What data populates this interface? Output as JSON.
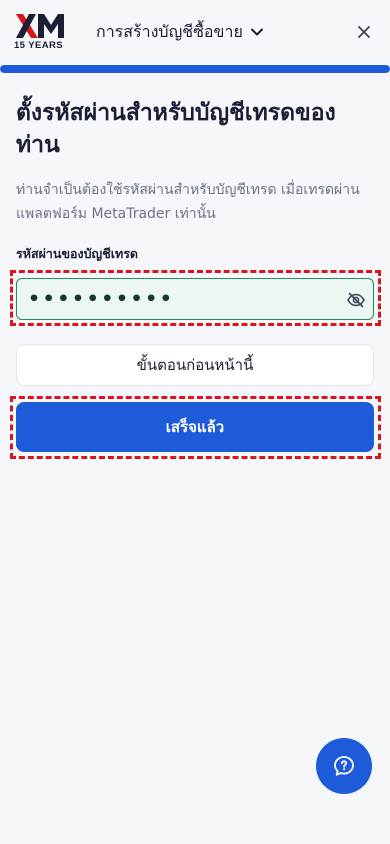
{
  "brand": {
    "logo_subtext": "15 YEARS",
    "accent_color": "#1d5bd8",
    "highlight_color": "#d8161b"
  },
  "header": {
    "breadcrumb": "การสร้างบัญชีซื้อขาย",
    "breadcrumb_icon": "chevron-down-icon",
    "close_icon": "close-icon"
  },
  "progress": {
    "fraction": 1.0
  },
  "main": {
    "title": "ตั้งรหัสผ่านสำหรับบัญชีเทรดของท่าน",
    "subtitle": "ท่านจำเป็นต้องใช้รหัสผ่านสำหรับบัญชีเทรด เมื่อเทรดผ่านแพลตฟอร์ม MetaTrader เท่านั้น",
    "password_field": {
      "label": "รหัสผ่านของบัญชีเทรด",
      "value": "••••••••••",
      "visibility_icon": "eye-off-icon"
    },
    "back_button": "ขั้นตอนก่อนหน้านี้",
    "done_button": "เสร็จแล้ว"
  },
  "help": {
    "icon": "chat-help-icon"
  }
}
